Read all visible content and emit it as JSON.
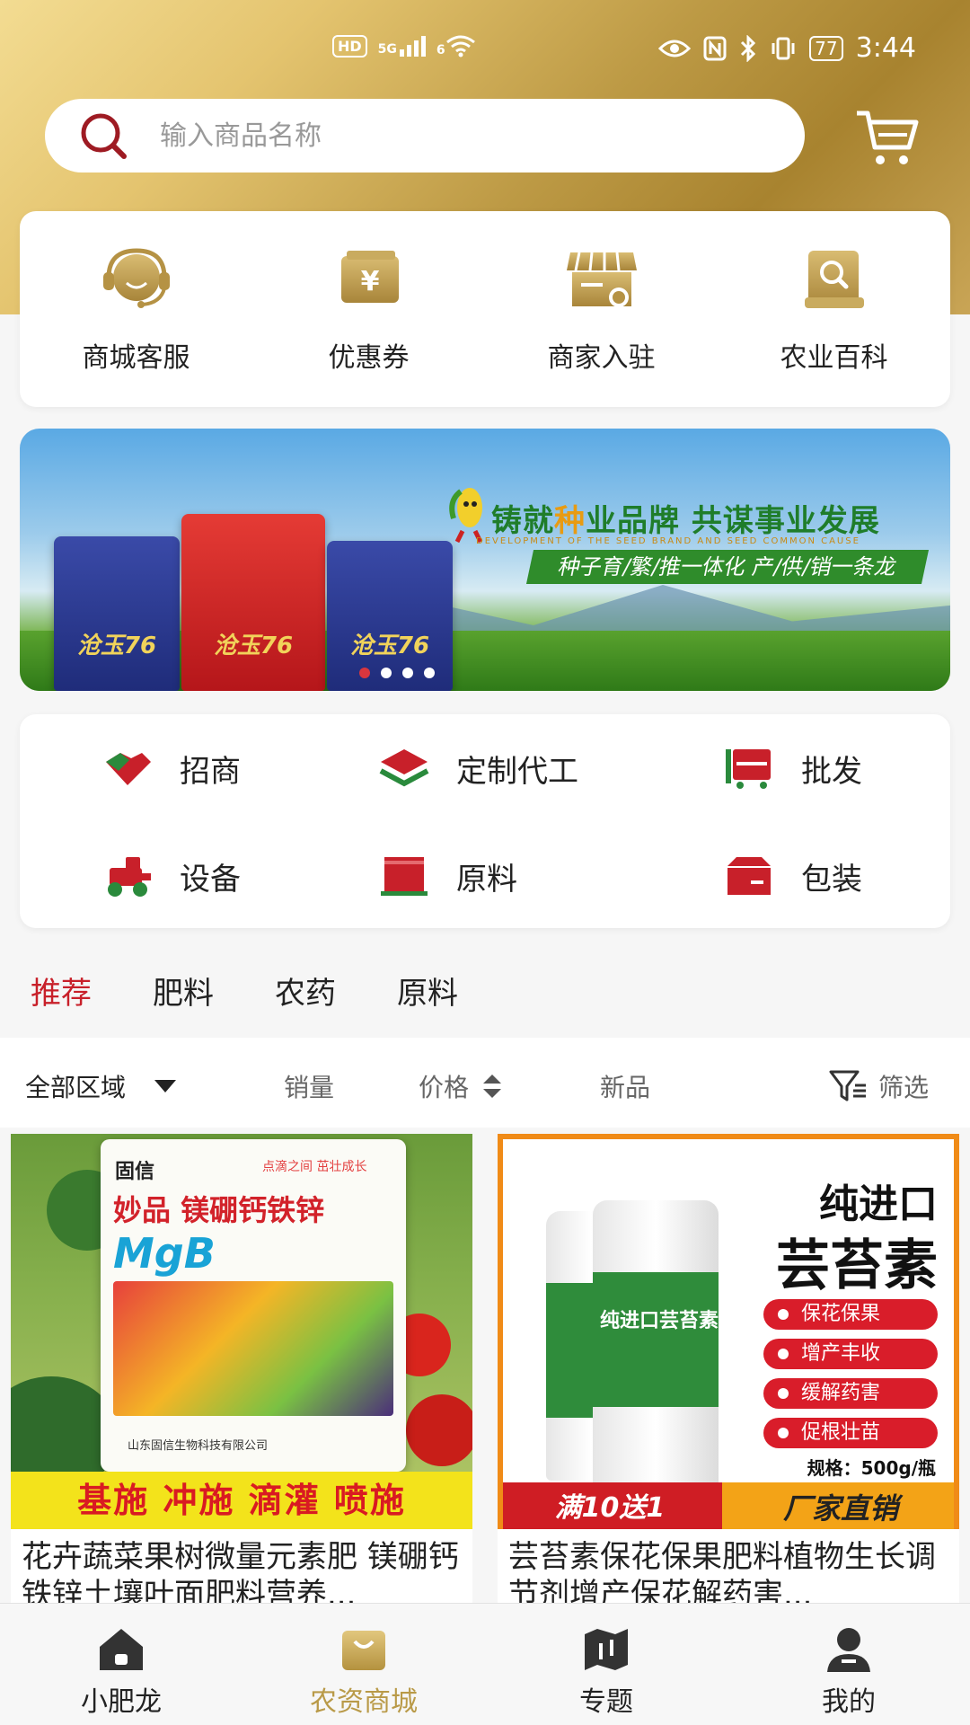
{
  "status_bar": {
    "left_icons": [
      "HD",
      "5G",
      "6"
    ],
    "battery": "77",
    "time": "3:44"
  },
  "search": {
    "placeholder": "输入商品名称",
    "value": ""
  },
  "quick_actions": [
    {
      "label": "商城客服",
      "icon": "customer-service-icon"
    },
    {
      "label": "优惠券",
      "icon": "coupon-icon"
    },
    {
      "label": "商家入驻",
      "icon": "store-icon"
    },
    {
      "label": "农业百科",
      "icon": "encyclopedia-icon"
    }
  ],
  "banner": {
    "title_a": "铸就",
    "title_hl": "种",
    "title_b": "业品牌  共谋事业发展",
    "subtitle_en": "DEVELOPMENT OF THE SEED BRAND AND SEED COMMON CAUSE",
    "slogan": "种子育/繁/推一体化  产/供/销一条龙",
    "bag_text": "沧玉76",
    "slide_count": 4,
    "active_slide": 1
  },
  "categories": [
    {
      "label": "招商",
      "icon": "handshake-icon"
    },
    {
      "label": "定制代工",
      "icon": "layers-icon"
    },
    {
      "label": "批发",
      "icon": "wholesale-truck-icon"
    },
    {
      "label": "设备",
      "icon": "tractor-icon"
    },
    {
      "label": "原料",
      "icon": "raw-material-icon"
    },
    {
      "label": "包装",
      "icon": "package-icon"
    }
  ],
  "tabs": [
    {
      "label": "推荐",
      "active": true
    },
    {
      "label": "肥料",
      "active": false
    },
    {
      "label": "农药",
      "active": false
    },
    {
      "label": "原料",
      "active": false
    }
  ],
  "filters": {
    "region": "全部区域",
    "sales": "销量",
    "price": "价格",
    "new": "新品",
    "filter": "筛选"
  },
  "products": [
    {
      "title": "花卉蔬菜果树微量元素肥 镁硼钙铁锌土壤叶面肥料营养...",
      "img": {
        "brand": "固信",
        "tag": "点滴之间  茁壮成长",
        "name": "妙品 镁硼钙铁锌",
        "formula": "MgB",
        "company": "山东固信生物科技有限公司",
        "bottom": "基施  冲施  滴灌  喷施"
      }
    },
    {
      "title": "芸苔素保花保果肥料植物生长调节剂增产保花解药害...",
      "img": {
        "title1": "纯进口",
        "title2": "芸苔素",
        "bottle_label": "纯进口芸苔素",
        "badges": [
          "保花保果",
          "增产丰收",
          "缓解药害",
          "促根壮苗"
        ],
        "spec": "规格：500g/瓶",
        "promo_left": "满10送1",
        "promo_right": "厂家直销"
      }
    }
  ],
  "bottom_nav": [
    {
      "label": "小肥龙",
      "icon": "home-icon",
      "active": false
    },
    {
      "label": "农资商城",
      "icon": "shopping-bag-icon",
      "active": true
    },
    {
      "label": "专题",
      "icon": "map-icon",
      "active": false
    },
    {
      "label": "我的",
      "icon": "user-icon",
      "active": false
    }
  ],
  "colors": {
    "gold": "#b99a48",
    "red": "#c8202a",
    "green": "#1f7d2a"
  }
}
